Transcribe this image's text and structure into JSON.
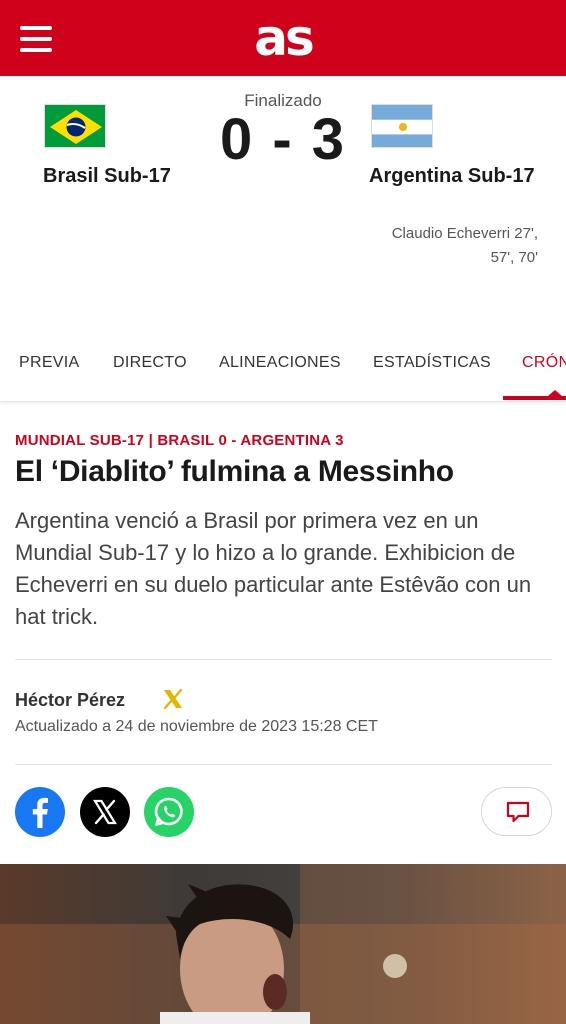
{
  "header": {
    "logo_text": "as",
    "brand_color": "#d0021b",
    "menu_icon": "hamburger-menu-icon"
  },
  "match": {
    "status": "Finalizado",
    "score": "0 - 3",
    "home": {
      "name": "Brasil Sub-17",
      "flag": "brazil-flag"
    },
    "away": {
      "name": "Argentina Sub-17",
      "flag": "argentina-flag",
      "scorers_line1": "Claudio Echeverri 27',",
      "scorers_line2": "57', 70'"
    }
  },
  "tabs": [
    {
      "label": "PREVIA"
    },
    {
      "label": "DIRECTO"
    },
    {
      "label": "ALINEACIONES"
    },
    {
      "label": "ESTADÍSTICAS"
    },
    {
      "label": "CRÓNICA",
      "active": true
    }
  ],
  "article": {
    "kicker": "MUNDIAL SUB-17 | BRASIL 0 - ARGENTINA 3",
    "headline": "El ‘Diablito’ fulmina a Messinho",
    "subtitle": "Argentina venció a Brasil por primera vez en un Mundial Sub-17 y lo hizo a lo grande. Exhibicion de Echeverri en su duelo particular ante Estêvão con un hat trick.",
    "author": "Héctor Pérez",
    "updated": "Actualizado a 24 de noviembre de 2023 15:28 CET"
  },
  "share": {
    "facebook_icon": "facebook-icon",
    "x_icon": "x-icon",
    "whatsapp_icon": "whatsapp-icon",
    "comments_icon": "comment-icon"
  }
}
